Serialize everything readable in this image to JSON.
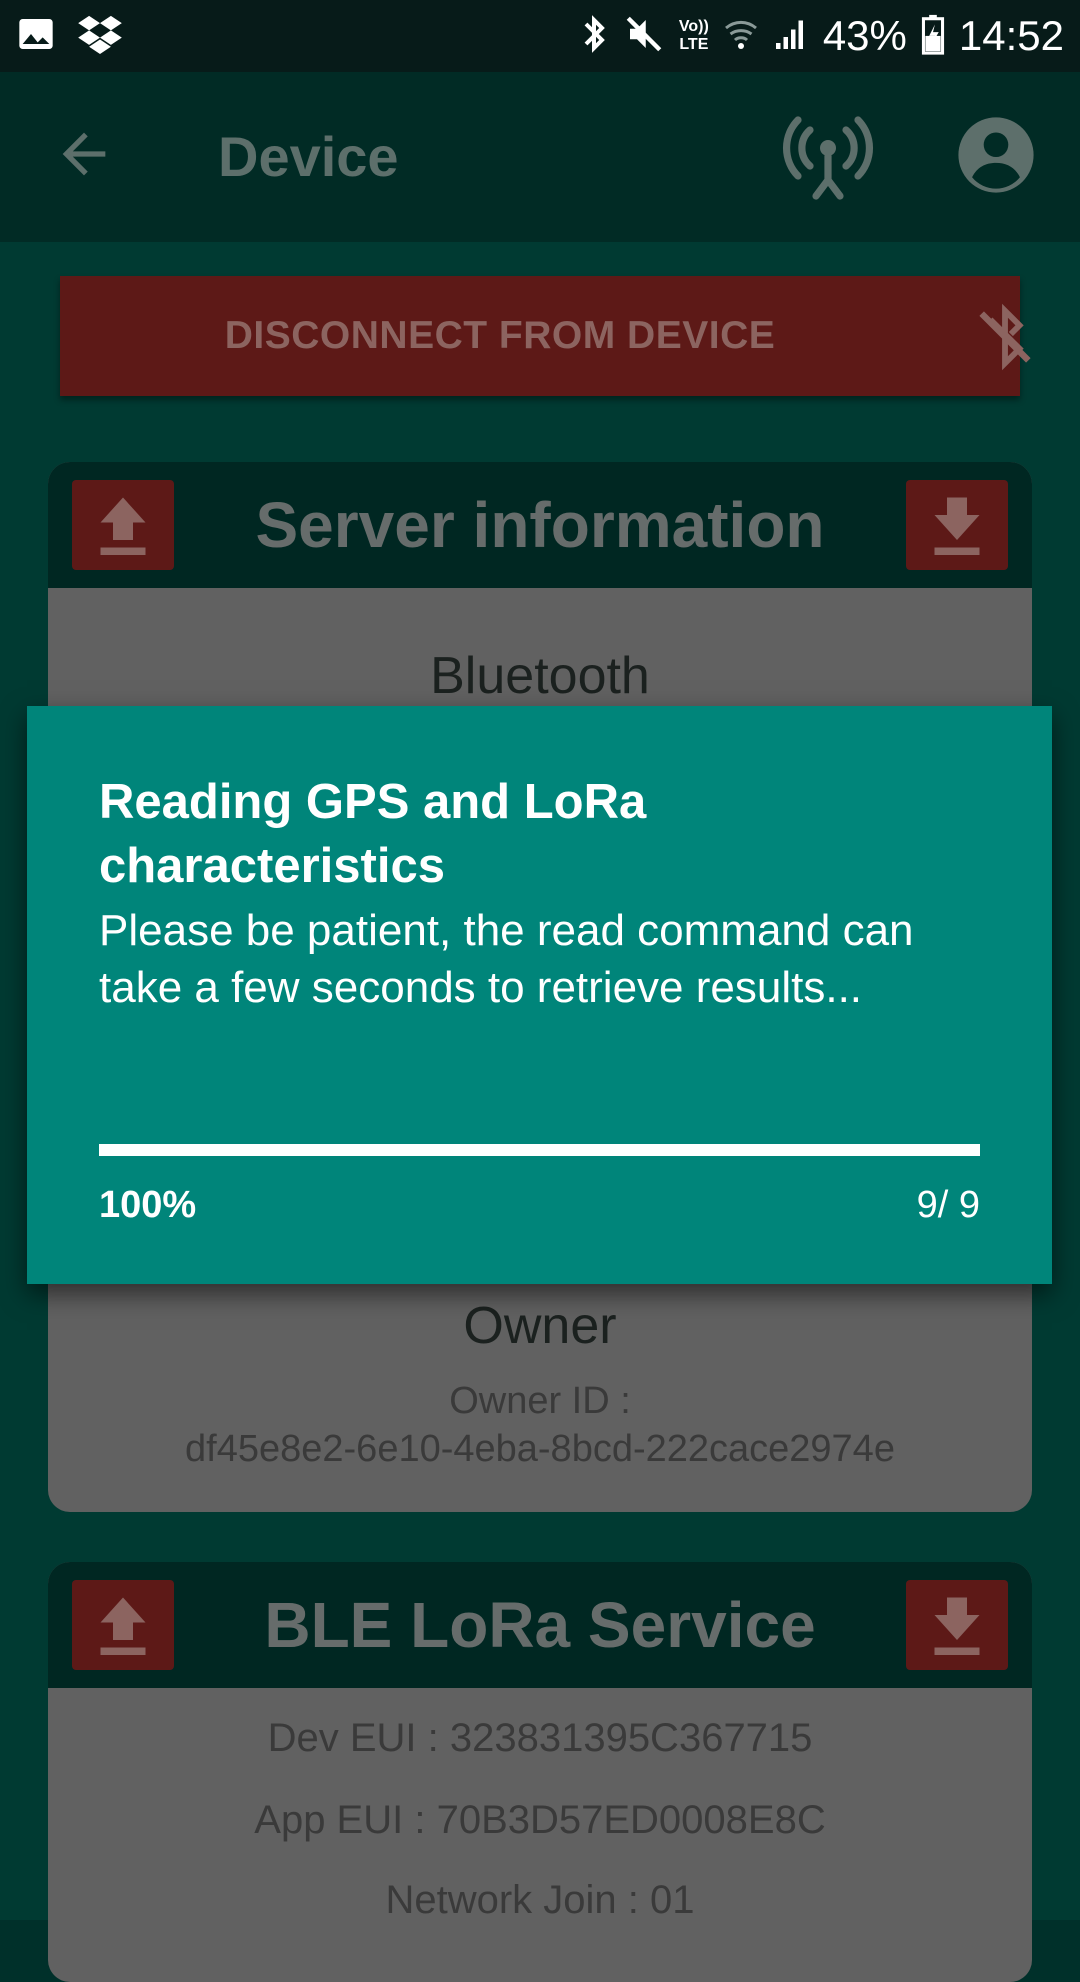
{
  "status_bar": {
    "left_icons": [
      "image-icon",
      "dropbox-icon"
    ],
    "right_icons": [
      "bluetooth-icon",
      "mute-icon",
      "volte-icon",
      "wifi-icon",
      "signal-icon",
      "battery-charging-icon"
    ],
    "volte_line1": "Vo))",
    "volte_line2": "LTE",
    "battery": "43%",
    "time": "14:52"
  },
  "toolbar": {
    "title": "Device",
    "icons": [
      "back-arrow-icon",
      "antenna-icon",
      "account-icon"
    ]
  },
  "disconnect_button": {
    "label": "DISCONNECT FROM DEVICE",
    "icon": "bluetooth-disabled-icon",
    "color": "#5d1917"
  },
  "server_card": {
    "title": "Server information",
    "upload_icon": "upload-icon",
    "download_icon": "download-icon",
    "bluetooth_heading": "Bluetooth",
    "owner_heading": "Owner",
    "owner_label": "Owner ID :",
    "owner_value": "df45e8e2-6e10-4eba-8bcd-222cace2974e"
  },
  "lora_card": {
    "title": "BLE LoRa Service",
    "rows": [
      "Dev EUI : 323831395C367715",
      "App EUI : 70B3D57ED0008E8C",
      "Network Join : 01"
    ]
  },
  "dialog": {
    "title": "Reading GPS and LoRa characteristics",
    "message": "Please be patient, the read command can take a few seconds to retrieve results...",
    "progress_fraction": 1.0,
    "percent_label": "100%",
    "count_label": "9/ 9",
    "color": "#00857a"
  }
}
